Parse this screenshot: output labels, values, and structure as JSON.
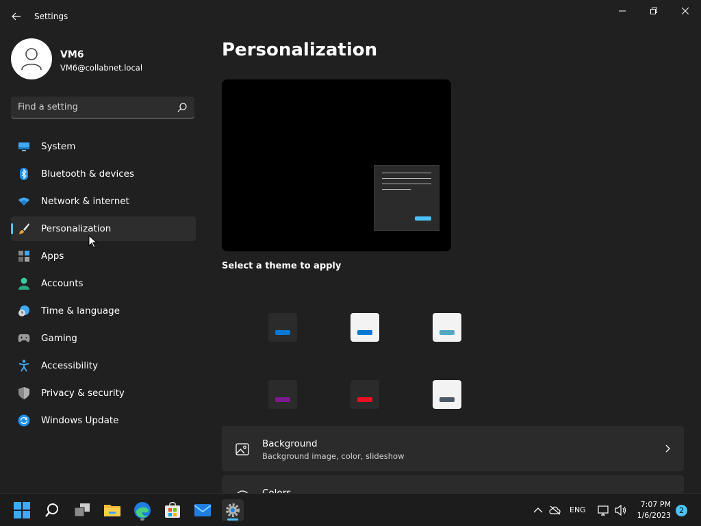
{
  "window": {
    "title": "Settings",
    "controls": [
      "minimize",
      "restore",
      "close"
    ]
  },
  "profile": {
    "name": "VM6",
    "email": "VM6@collabnet.local"
  },
  "search": {
    "placeholder": "Find a setting"
  },
  "sidebar": {
    "items": [
      {
        "label": "System",
        "icon": "monitor-icon"
      },
      {
        "label": "Bluetooth & devices",
        "icon": "bluetooth-icon"
      },
      {
        "label": "Network & internet",
        "icon": "wifi-icon"
      },
      {
        "label": "Personalization",
        "icon": "brush-icon",
        "active": true
      },
      {
        "label": "Apps",
        "icon": "apps-icon"
      },
      {
        "label": "Accounts",
        "icon": "person-icon"
      },
      {
        "label": "Time & language",
        "icon": "clock-globe-icon"
      },
      {
        "label": "Gaming",
        "icon": "gamepad-icon"
      },
      {
        "label": "Accessibility",
        "icon": "accessibility-icon"
      },
      {
        "label": "Privacy & security",
        "icon": "shield-icon"
      },
      {
        "label": "Windows Update",
        "icon": "update-icon"
      }
    ]
  },
  "main": {
    "title": "Personalization",
    "theme_label": "Select a theme to apply",
    "themes": [
      {
        "bg": "#2b2b2b",
        "accent": "#0078d4"
      },
      {
        "bg": "#f3f3f3",
        "accent": "#0078d4"
      },
      {
        "bg": "#f3f3f3",
        "accent": "#55a7c0"
      },
      {
        "bg": "#2b2b2b",
        "accent": "#7a1a8c"
      },
      {
        "bg": "#2b2b2b",
        "accent": "#e81123"
      },
      {
        "bg": "#f3f3f3",
        "accent": "#4b5a66"
      }
    ],
    "cards": [
      {
        "title": "Background",
        "subtitle": "Background image, color, slideshow",
        "icon": "image-icon"
      },
      {
        "title": "Colors",
        "subtitle": "",
        "icon": "palette-icon"
      }
    ]
  },
  "taskbar": {
    "language": "ENG",
    "time": "7:07 PM",
    "date": "1/6/2023",
    "notification_count": "2"
  },
  "colors": {
    "accent": "#4cc2ff",
    "background": "#202020",
    "card": "#2b2b2b"
  }
}
